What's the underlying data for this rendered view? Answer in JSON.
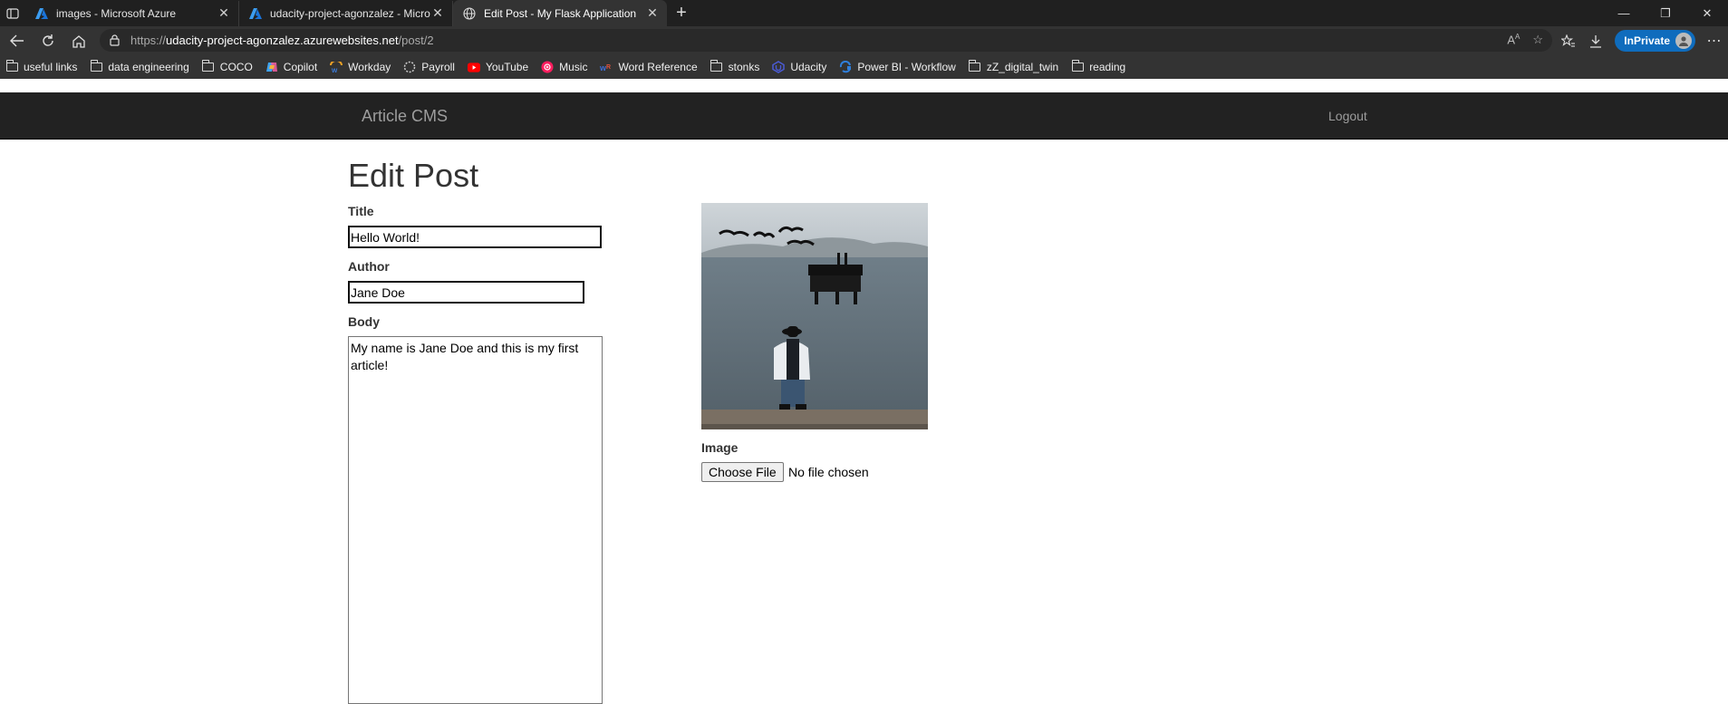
{
  "browser": {
    "tabs": [
      {
        "title": "images - Microsoft Azure",
        "icon": "azure-icon",
        "active": false
      },
      {
        "title": "udacity-project-agonzalez - Microsoft Azure",
        "icon": "azure-icon",
        "active": false
      },
      {
        "title": "Edit Post - My Flask Application",
        "icon": "globe-icon",
        "active": true
      }
    ],
    "address": {
      "scheme": "https://",
      "host": "udacity-project-agonzalez.azurewebsites.net",
      "path": "/post/2"
    },
    "inprivate_label": "InPrivate",
    "bookmarks": [
      {
        "label": "useful links",
        "icon": "folder-icon"
      },
      {
        "label": "data engineering",
        "icon": "folder-icon"
      },
      {
        "label": "COCO",
        "icon": "folder-icon"
      },
      {
        "label": "Copilot",
        "icon": "copilot-icon"
      },
      {
        "label": "Workday",
        "icon": "workday-icon"
      },
      {
        "label": "Payroll",
        "icon": "payroll-icon"
      },
      {
        "label": "YouTube",
        "icon": "youtube-icon"
      },
      {
        "label": "Music",
        "icon": "music-icon"
      },
      {
        "label": "Word Reference",
        "icon": "wordreference-icon"
      },
      {
        "label": "stonks",
        "icon": "folder-icon"
      },
      {
        "label": "Udacity",
        "icon": "udacity-icon"
      },
      {
        "label": "Power BI - Workflow",
        "icon": "powerbi-icon"
      },
      {
        "label": "zZ_digital_twin",
        "icon": "folder-icon"
      },
      {
        "label": "reading",
        "icon": "folder-icon"
      }
    ]
  },
  "app": {
    "brand": "Article CMS",
    "logout": "Logout"
  },
  "form": {
    "heading": "Edit Post",
    "title_label": "Title",
    "title_value": "Hello World!",
    "author_label": "Author",
    "author_value": "Jane Doe",
    "body_label": "Body",
    "body_value": "My name is Jane Doe and this is my first article!",
    "image_label": "Image",
    "choose_file": "Choose File",
    "no_file": "No file chosen"
  },
  "colors": {
    "navbar": "#222222",
    "browser_chrome": "#333333",
    "tabstrip": "#202020",
    "inprivate": "#0f6cbd"
  }
}
